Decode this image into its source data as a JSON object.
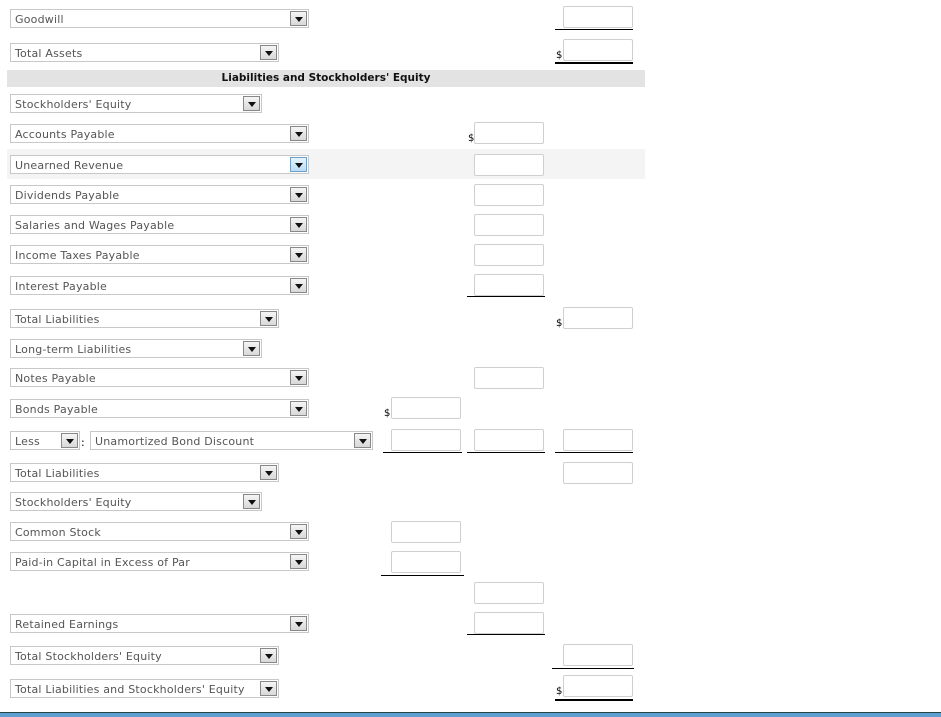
{
  "section_header": "Liabilities and Stockholders' Equity",
  "currency_symbol": "$",
  "rows": [
    {
      "label": "Goodwill"
    },
    {
      "label": "Total Assets"
    },
    {
      "label": "Stockholders' Equity"
    },
    {
      "label": "Accounts Payable"
    },
    {
      "label": "Unearned Revenue"
    },
    {
      "label": "Dividends Payable"
    },
    {
      "label": "Salaries and Wages Payable"
    },
    {
      "label": "Income Taxes Payable"
    },
    {
      "label": "Interest Payable"
    },
    {
      "label": "Total Liabilities"
    },
    {
      "label": "Long-term Liabilities"
    },
    {
      "label": "Notes Payable"
    },
    {
      "label": "Bonds Payable"
    },
    {
      "label": "Less",
      "label2": "Unamortized Bond Discount"
    },
    {
      "label": "Total Liabilities"
    },
    {
      "label": "Stockholders' Equity"
    },
    {
      "label": "Common Stock"
    },
    {
      "label": "Paid-in Capital in Excess of Par"
    },
    {
      "label": "Retained Earnings"
    },
    {
      "label": "Total Stockholders' Equity"
    },
    {
      "label": "Total Liabilities and Stockholders' Equity"
    }
  ],
  "colon": ":"
}
